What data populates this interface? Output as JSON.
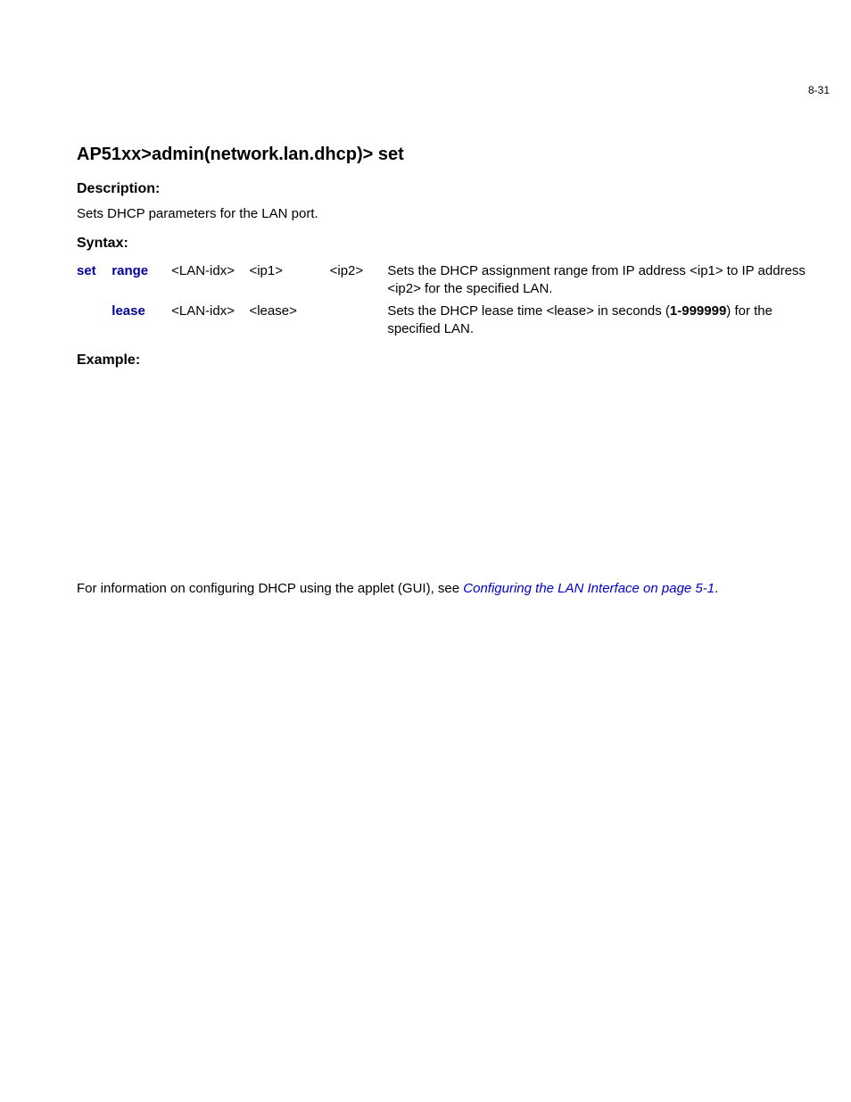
{
  "page_number": "8-31",
  "title": "AP51xx>admin(network.lan.dhcp)> set",
  "headings": {
    "description": "Description:",
    "syntax": "Syntax:",
    "example": "Example:"
  },
  "description_text": "Sets DHCP parameters for the LAN port.",
  "syntax": {
    "cmd": "set",
    "rows": [
      {
        "sub": "range",
        "args": [
          "<LAN-idx>",
          "<ip1>",
          "<ip2>"
        ],
        "desc_pre": "Sets the DHCP assignment range from IP address <ip1> to IP address <ip2> for the specified LAN.",
        "desc_bold": "",
        "desc_post": ""
      },
      {
        "sub": "lease",
        "args": [
          "<LAN-idx>",
          "<lease>",
          ""
        ],
        "desc_pre": "Sets the DHCP lease time <lease> in seconds (",
        "desc_bold": "1-999999",
        "desc_post": ") for the specified LAN."
      }
    ]
  },
  "footer": {
    "text_before": "For information on configuring DHCP using the applet (GUI), see ",
    "link_text": "Configuring the LAN Interface on page 5-1",
    "text_after": "."
  }
}
